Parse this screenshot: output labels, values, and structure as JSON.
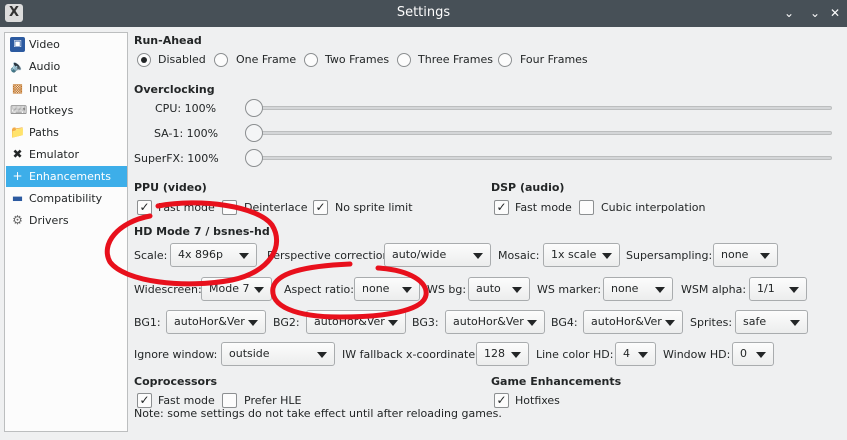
{
  "window": {
    "title": "Settings",
    "app_icon": "X"
  },
  "sidebar": {
    "items": [
      {
        "label": "Video",
        "icon": "monitor-icon"
      },
      {
        "label": "Audio",
        "icon": "speaker-icon"
      },
      {
        "label": "Input",
        "icon": "gamepad-icon"
      },
      {
        "label": "Hotkeys",
        "icon": "keyboard-icon"
      },
      {
        "label": "Paths",
        "icon": "folder-icon"
      },
      {
        "label": "Emulator",
        "icon": "tools-icon"
      },
      {
        "label": "Enhancements",
        "icon": "plus-icon",
        "active": true
      },
      {
        "label": "Compatibility",
        "icon": "minus-icon"
      },
      {
        "label": "Drivers",
        "icon": "gear-icon"
      }
    ]
  },
  "run_ahead": {
    "title": "Run-Ahead",
    "options": [
      "Disabled",
      "One Frame",
      "Two Frames",
      "Three Frames",
      "Four Frames"
    ],
    "selected": "Disabled"
  },
  "overclocking": {
    "title": "Overclocking",
    "sliders": [
      {
        "label": "CPU:",
        "value": "100%",
        "level": 0
      },
      {
        "label": "SA-1:",
        "value": "100%",
        "level": 0
      },
      {
        "label": "SuperFX:",
        "value": "100%",
        "level": 0
      }
    ]
  },
  "ppu": {
    "title": "PPU (video)",
    "fast_mode": "Fast mode",
    "deinterlace": "Deinterlace",
    "no_sprite_limit": "No sprite limit"
  },
  "dsp": {
    "title": "DSP (audio)",
    "fast_mode": "Fast mode",
    "cubic": "Cubic interpolation"
  },
  "hd": {
    "title": "HD Mode 7 / bsnes-hd",
    "scale_label": "Scale:",
    "scale_value": "4x  896p",
    "perspective_label": "Perspective correction:",
    "perspective_value": "auto/wide",
    "mosaic_label": "Mosaic:",
    "mosaic_value": "1x scale",
    "supersampling_label": "Supersampling:",
    "supersampling_value": "none",
    "widescreen_label": "Widescreen:",
    "widescreen_value": "Mode 7",
    "aspect_label": "Aspect ratio:",
    "aspect_value": "none",
    "wsbg_label": "WS bg:",
    "wsbg_value": "auto",
    "wsmarker_label": "WS marker:",
    "wsmarker_value": "none",
    "wsmalpha_label": "WSM alpha:",
    "wsmalpha_value": "1/1",
    "bg1_label": "BG1:",
    "bg1_value": "autoHor&Ver",
    "bg2_label": "BG2:",
    "bg2_value": "autoHor&Ver",
    "bg3_label": "BG3:",
    "bg3_value": "autoHor&Ver",
    "bg4_label": "BG4:",
    "bg4_value": "autoHor&Ver",
    "sprites_label": "Sprites:",
    "sprites_value": "safe",
    "ignore_label": "Ignore window:",
    "ignore_value": "outside",
    "iwx_label": "IW fallback x-coordinate:",
    "iwx_value": "128",
    "linecolor_label": "Line color HD:",
    "linecolor_value": "4",
    "windowhd_label": "Window HD:",
    "windowhd_value": "0"
  },
  "coprocessors": {
    "title": "Coprocessors",
    "fast_mode": "Fast mode",
    "prefer_hle": "Prefer HLE"
  },
  "game_enhancements": {
    "title": "Game Enhancements",
    "hotfixes": "Hotfixes"
  },
  "note": "Note: some settings do not take effect until after reloading games.",
  "colors": {
    "accent": "#3daee9",
    "annotation": "#e8101c",
    "titlebar": "#475057"
  }
}
